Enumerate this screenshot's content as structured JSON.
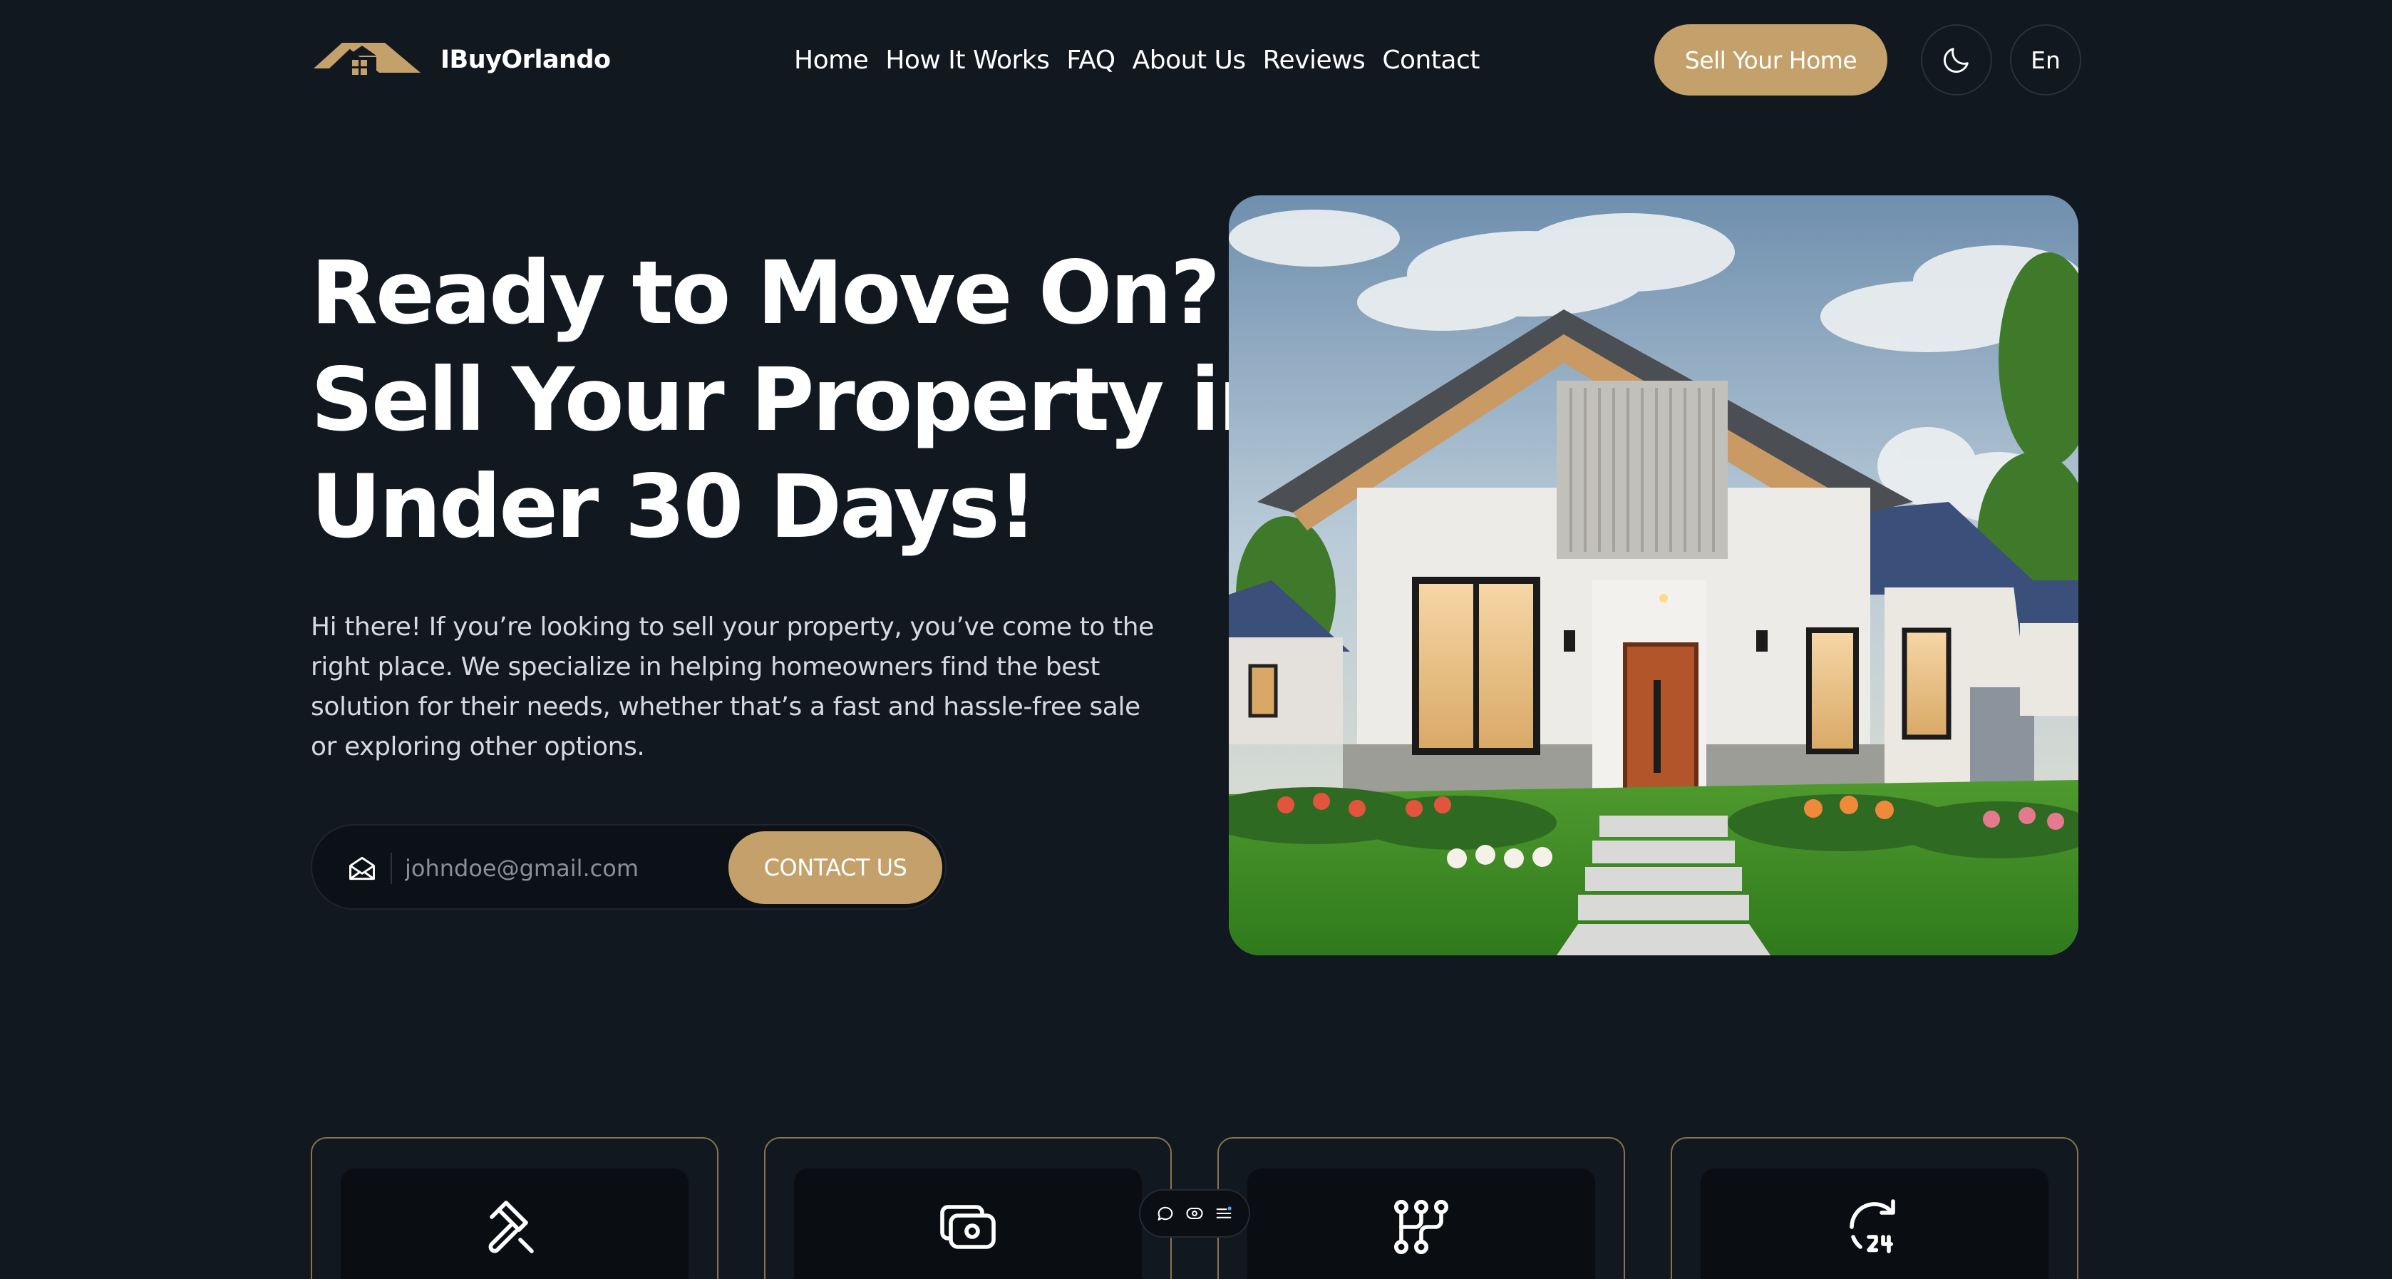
{
  "header": {
    "brand": "IBuyOrlando",
    "nav": [
      "Home",
      "How It Works",
      "FAQ",
      "About Us",
      "Reviews",
      "Contact"
    ],
    "cta": "Sell Your Home",
    "theme_icon": "moon-icon",
    "language": "En"
  },
  "hero": {
    "title_lines": [
      "Ready to Move On?",
      "Sell Your Property in",
      "Under 30 Days!"
    ],
    "description": "Hi there! If you’re looking to sell your property, you’ve come to the right place. We specialize in helping homeowners find the best solution for their needs, whether that’s a fast and hassle-free sale or exploring other options.",
    "email_placeholder": "johndoe@gmail.com",
    "contact_button": "CONTACT US",
    "email_icon": "envelope-open-icon"
  },
  "features": {
    "icons": [
      "gavel-icon",
      "cash-icon",
      "workflow-icon",
      "24-hour-icon"
    ]
  },
  "floating_toolbar": {
    "icons": [
      "chat-icon",
      "eye-icon",
      "list-icon"
    ]
  },
  "colors": {
    "background": "#121820",
    "accent": "#c4a06a",
    "card_border": "#8a7350"
  }
}
